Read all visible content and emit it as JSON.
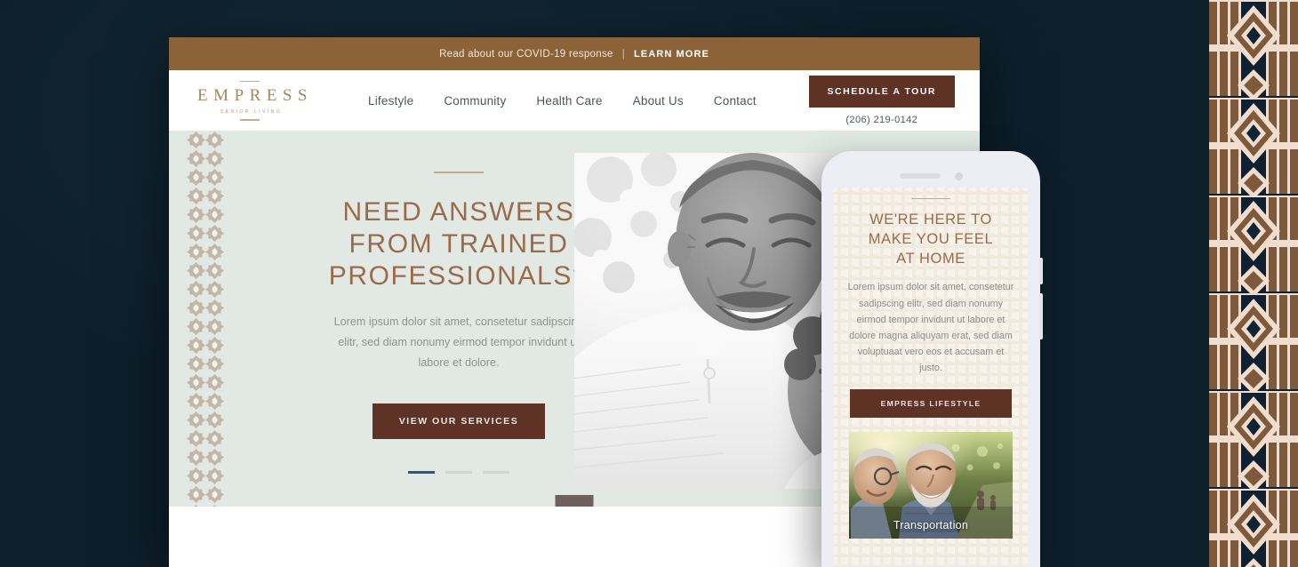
{
  "theme": {
    "backdrop": "#0d1f2b",
    "announce_bg": "#8c6239",
    "brand_brown": "#5e3225",
    "heading_brown": "#9a6b4a",
    "hero_bg": "#e2e9e4",
    "logo_gold": "#a9855f",
    "dot_active": "#3b5566"
  },
  "announcement": {
    "text": "Read about our COVID-19 response",
    "separator": "|",
    "link_label": "LEARN MORE"
  },
  "header": {
    "logo": {
      "word": "EMPRESS",
      "sub": "SENIOR LIVING"
    },
    "nav": [
      {
        "label": "Lifestyle"
      },
      {
        "label": "Community"
      },
      {
        "label": "Health Care"
      },
      {
        "label": "About Us"
      },
      {
        "label": "Contact"
      }
    ],
    "cta_label": "SCHEDULE A TOUR",
    "phone": "(206) 219-0142"
  },
  "hero": {
    "title_line1": "NEED ANSWERS",
    "title_line2": "FROM TRAINED",
    "title_line3": "PROFESSIONALS?",
    "body": "Lorem ipsum dolor sit amet, consetetur sadipscing elitr, sed diam nonumy eirmod tempor invidunt ut labore et dolore.",
    "cta_label": "VIEW OUR SERVICES",
    "slides": [
      {
        "active": true
      },
      {
        "active": false
      },
      {
        "active": false
      }
    ],
    "photo_alt": "Smiling senior couple embracing outdoors"
  },
  "phone_mockup": {
    "title_line1": "WE'RE HERE TO",
    "title_line2": "MAKE YOU FEEL",
    "title_line3": "AT HOME",
    "body": "Lorem ipsum dolor sit amet, consetetur sadipscing elitr, sed diam nonumy eirmod tempor invidunt ut labore et dolore magna aliquyam erat, sed diam voluptuaat vero eos et accusam et justo.",
    "cta_label": "EMPRESS LIFESTYLE",
    "card_caption": "Transportation"
  }
}
